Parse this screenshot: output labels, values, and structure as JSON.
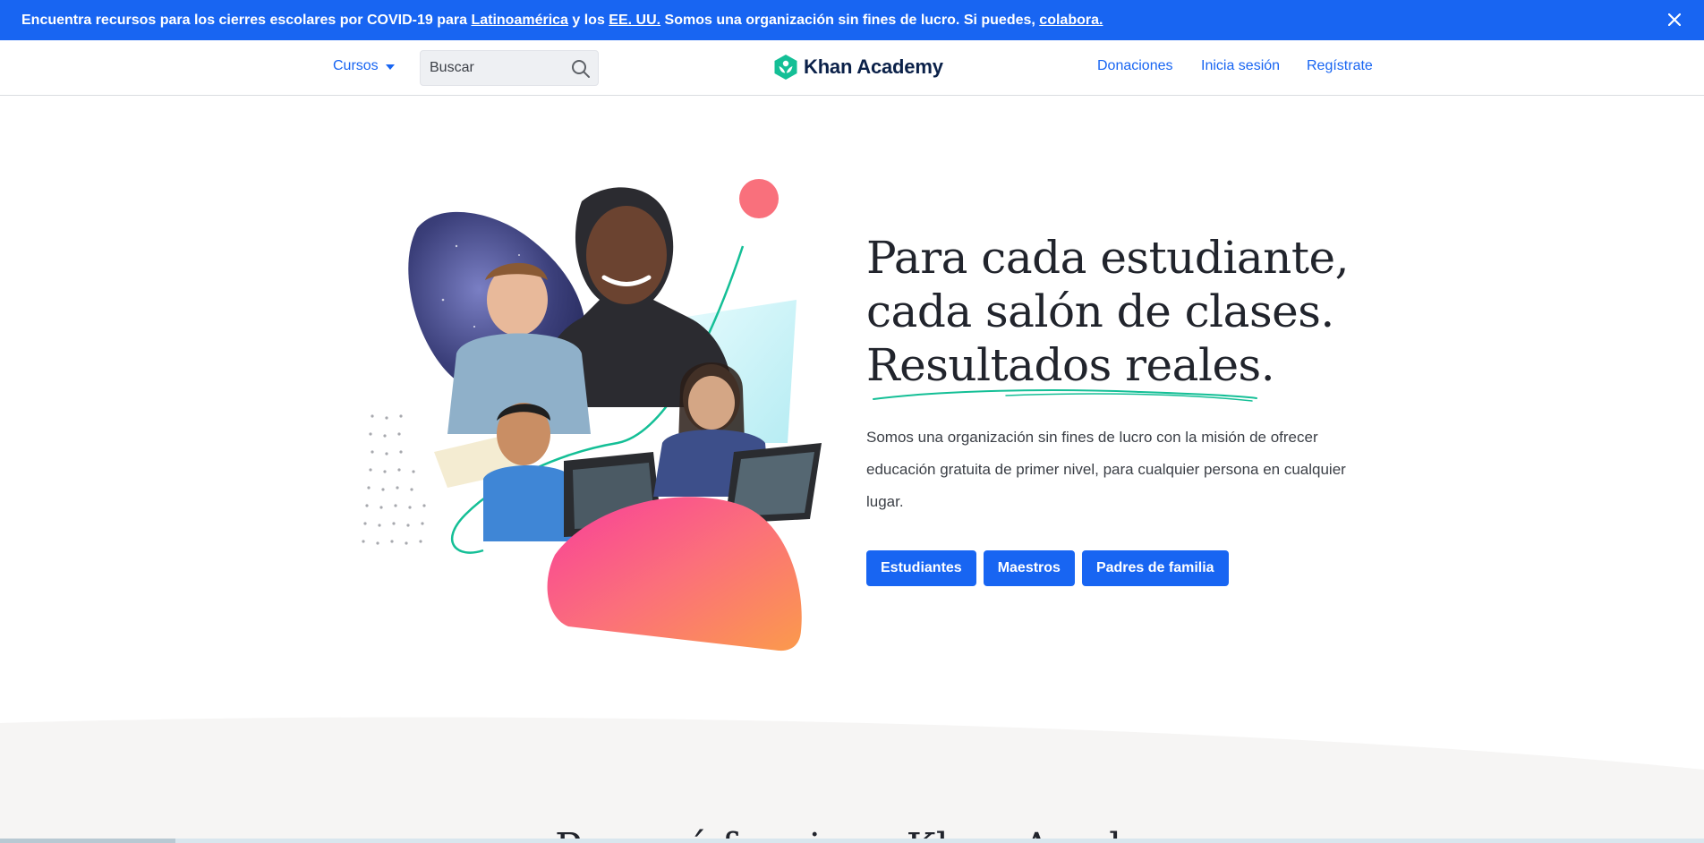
{
  "banner": {
    "text_1": "Encuentra recursos para los cierres escolares por COVID-19 para ",
    "link_latam": "Latinoamérica",
    "text_2": " y los ",
    "link_us": "EE. UU.",
    "text_3": " Somos una organización sin fines de lucro. Si puedes, ",
    "link_donate": "colabora.",
    "close_icon": "close-icon",
    "background": "#1865f2"
  },
  "header": {
    "courses_label": "Cursos",
    "search_placeholder": "Buscar",
    "logo_text": "Khan Academy",
    "donate_label": "Donaciones",
    "login_label": "Inicia sesión",
    "signup_label": "Regístrate"
  },
  "hero": {
    "headline_line1": "Para cada estudiante,",
    "headline_line2": "cada salón de clases.",
    "headline_line3": "Resultados reales.",
    "description": "Somos una organización sin fines de lucro con la misión de ofrecer educación gratuita de primer nivel, para cualquier persona en cualquier lugar.",
    "buttons": {
      "students": "Estudiantes",
      "teachers": "Maestros",
      "parents": "Padres de familia"
    }
  },
  "section2": {
    "heading_partial": "Por qué funciona Khan Academy"
  },
  "colors": {
    "accent": "#1865f2",
    "brand_green": "#14bf96",
    "text": "#21242c"
  }
}
